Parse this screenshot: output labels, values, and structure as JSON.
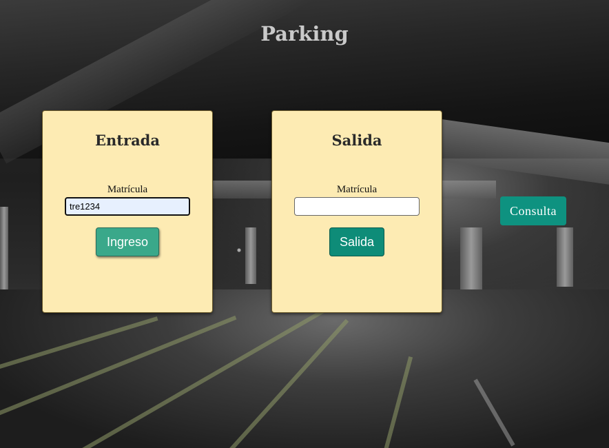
{
  "page": {
    "title": "Parking"
  },
  "entrada": {
    "heading": "Entrada",
    "field_label": "Matrícula",
    "field_value": "tre1234",
    "button_label": "Ingreso"
  },
  "salida": {
    "heading": "Salida",
    "field_label": "Matrícula",
    "field_value": "",
    "button_label": "Salida"
  },
  "consulta": {
    "button_label": "Consulta"
  },
  "colors": {
    "card_background": "#fdebb3",
    "primary_button": "#0e8c78",
    "title_text": "#c9c9c9"
  }
}
